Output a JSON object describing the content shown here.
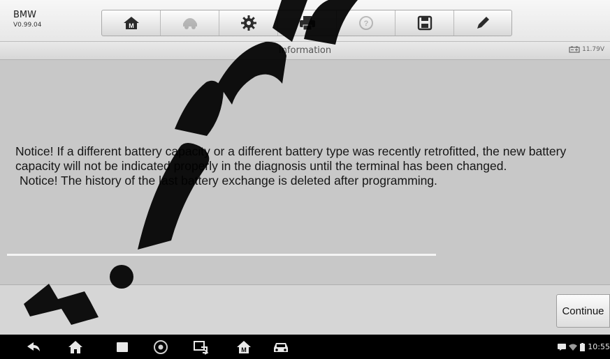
{
  "app": {
    "name": "BMW",
    "version": "V0.99.04"
  },
  "toolbar": {
    "buttons": [
      {
        "icon": "home-icon",
        "enabled": true
      },
      {
        "icon": "vehicle-swap-icon",
        "enabled": false
      },
      {
        "icon": "gear-icon",
        "enabled": true
      },
      {
        "icon": "printer-icon",
        "enabled": true
      },
      {
        "icon": "help-icon",
        "enabled": false
      },
      {
        "icon": "save-icon",
        "enabled": true
      },
      {
        "icon": "pen-icon",
        "enabled": true
      }
    ]
  },
  "titlebar": {
    "title": "Information",
    "battery_voltage": "11.79V"
  },
  "message": {
    "paragraph1": "Notice! If a different battery capacity or a different battery type was recently retrofitted, the new battery capacity will not be indicated properly in the diagnosis until the terminal has been changed.",
    "paragraph2": "Notice! The history of the last battery exchange is deleted after programming."
  },
  "footer": {
    "continue_label": "Continue"
  },
  "navbar": {
    "buttons": [
      "back-icon",
      "home-icon",
      "recent-apps-icon",
      "browser-icon",
      "screen-capture-icon",
      "app-home-icon",
      "vehicle-icon"
    ],
    "clock": "10:55"
  },
  "colors": {
    "background": "#c8c8c8",
    "watermark": "#000000",
    "navbar": "#000000"
  }
}
